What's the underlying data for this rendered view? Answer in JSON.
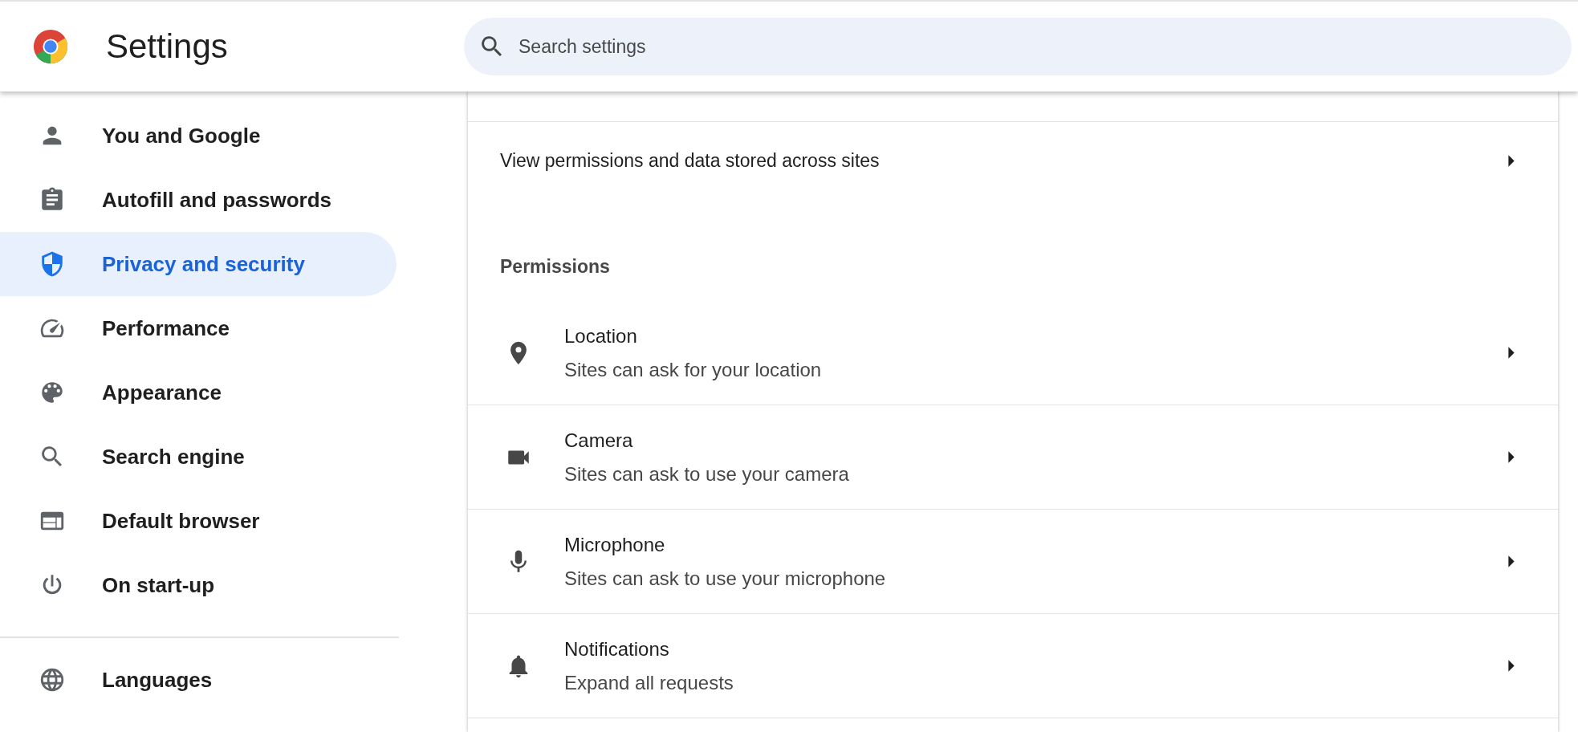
{
  "header": {
    "title": "Settings",
    "search": {
      "placeholder": "Search settings"
    }
  },
  "sidebar": {
    "items": [
      {
        "label": "You and Google",
        "kind": "person",
        "selected": false
      },
      {
        "label": "Autofill and passwords",
        "kind": "clipboard",
        "selected": false
      },
      {
        "label": "Privacy and security",
        "kind": "shield",
        "selected": true
      },
      {
        "label": "Performance",
        "kind": "gauge",
        "selected": false
      },
      {
        "label": "Appearance",
        "kind": "palette",
        "selected": false
      },
      {
        "label": "Search engine",
        "kind": "search",
        "selected": false
      },
      {
        "label": "Default browser",
        "kind": "browser",
        "selected": false
      },
      {
        "label": "On start-up",
        "kind": "power",
        "selected": false
      }
    ],
    "more_items": [
      {
        "label": "Languages",
        "kind": "globe",
        "selected": false
      }
    ]
  },
  "content": {
    "link_row": {
      "label": "View permissions and data stored across sites"
    },
    "section_title": "Permissions",
    "permissions": [
      {
        "title": "Location",
        "subtitle": "Sites can ask for your location",
        "kind": "pin"
      },
      {
        "title": "Camera",
        "subtitle": "Sites can ask to use your camera",
        "kind": "camera"
      },
      {
        "title": "Microphone",
        "subtitle": "Sites can ask to use your microphone",
        "kind": "mic"
      },
      {
        "title": "Notifications",
        "subtitle": "Expand all requests",
        "kind": "bell"
      }
    ]
  }
}
